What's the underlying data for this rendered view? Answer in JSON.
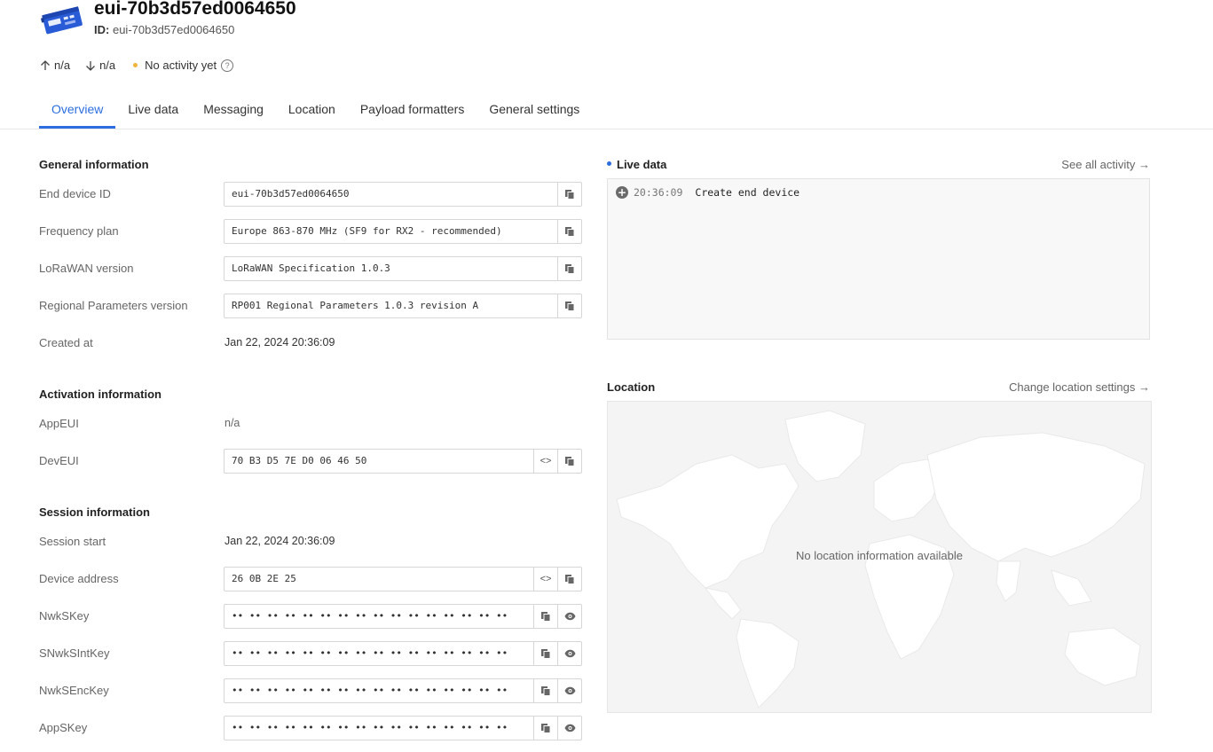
{
  "header": {
    "title": "eui-70b3d57ed0064650",
    "id_label": "ID:",
    "id_value": "eui-70b3d57ed0064650",
    "uplink": "n/a",
    "downlink": "n/a",
    "activity": "No activity yet"
  },
  "tabs": [
    "Overview",
    "Live data",
    "Messaging",
    "Location",
    "Payload formatters",
    "General settings"
  ],
  "general": {
    "title": "General information",
    "end_device_id_label": "End device ID",
    "end_device_id": "eui-70b3d57ed0064650",
    "frequency_plan_label": "Frequency plan",
    "frequency_plan": "Europe 863-870 MHz (SF9 for RX2 - recommended)",
    "lorawan_version_label": "LoRaWAN version",
    "lorawan_version": "LoRaWAN Specification 1.0.3",
    "regional_params_label": "Regional Parameters version",
    "regional_params": "RP001 Regional Parameters 1.0.3 revision A",
    "created_at_label": "Created at",
    "created_at": "Jan 22, 2024 20:36:09"
  },
  "activation": {
    "title": "Activation information",
    "appeui_label": "AppEUI",
    "appeui": "n/a",
    "deveui_label": "DevEUI",
    "deveui": "70 B3 D5 7E D0 06 46 50"
  },
  "session": {
    "title": "Session information",
    "start_label": "Session start",
    "start": "Jan 22, 2024 20:36:09",
    "dev_addr_label": "Device address",
    "dev_addr": "26 0B 2E 25",
    "nwkskey_label": "NwkSKey",
    "snwksintkey_label": "SNwkSIntKey",
    "nwksenckey_label": "NwkSEncKey",
    "appskey_label": "AppSKey",
    "masked": "•• •• •• •• •• •• •• •• •• •• •• •• •• •• •• ••"
  },
  "live": {
    "title": "Live data",
    "link": "See all activity →",
    "time": "20:36:09",
    "event": "Create end device"
  },
  "location": {
    "title": "Location",
    "link": "Change location settings →",
    "empty": "No location information available"
  },
  "colors": {
    "accent": "#2c6ee0",
    "status_dot": "#f0b43a"
  }
}
